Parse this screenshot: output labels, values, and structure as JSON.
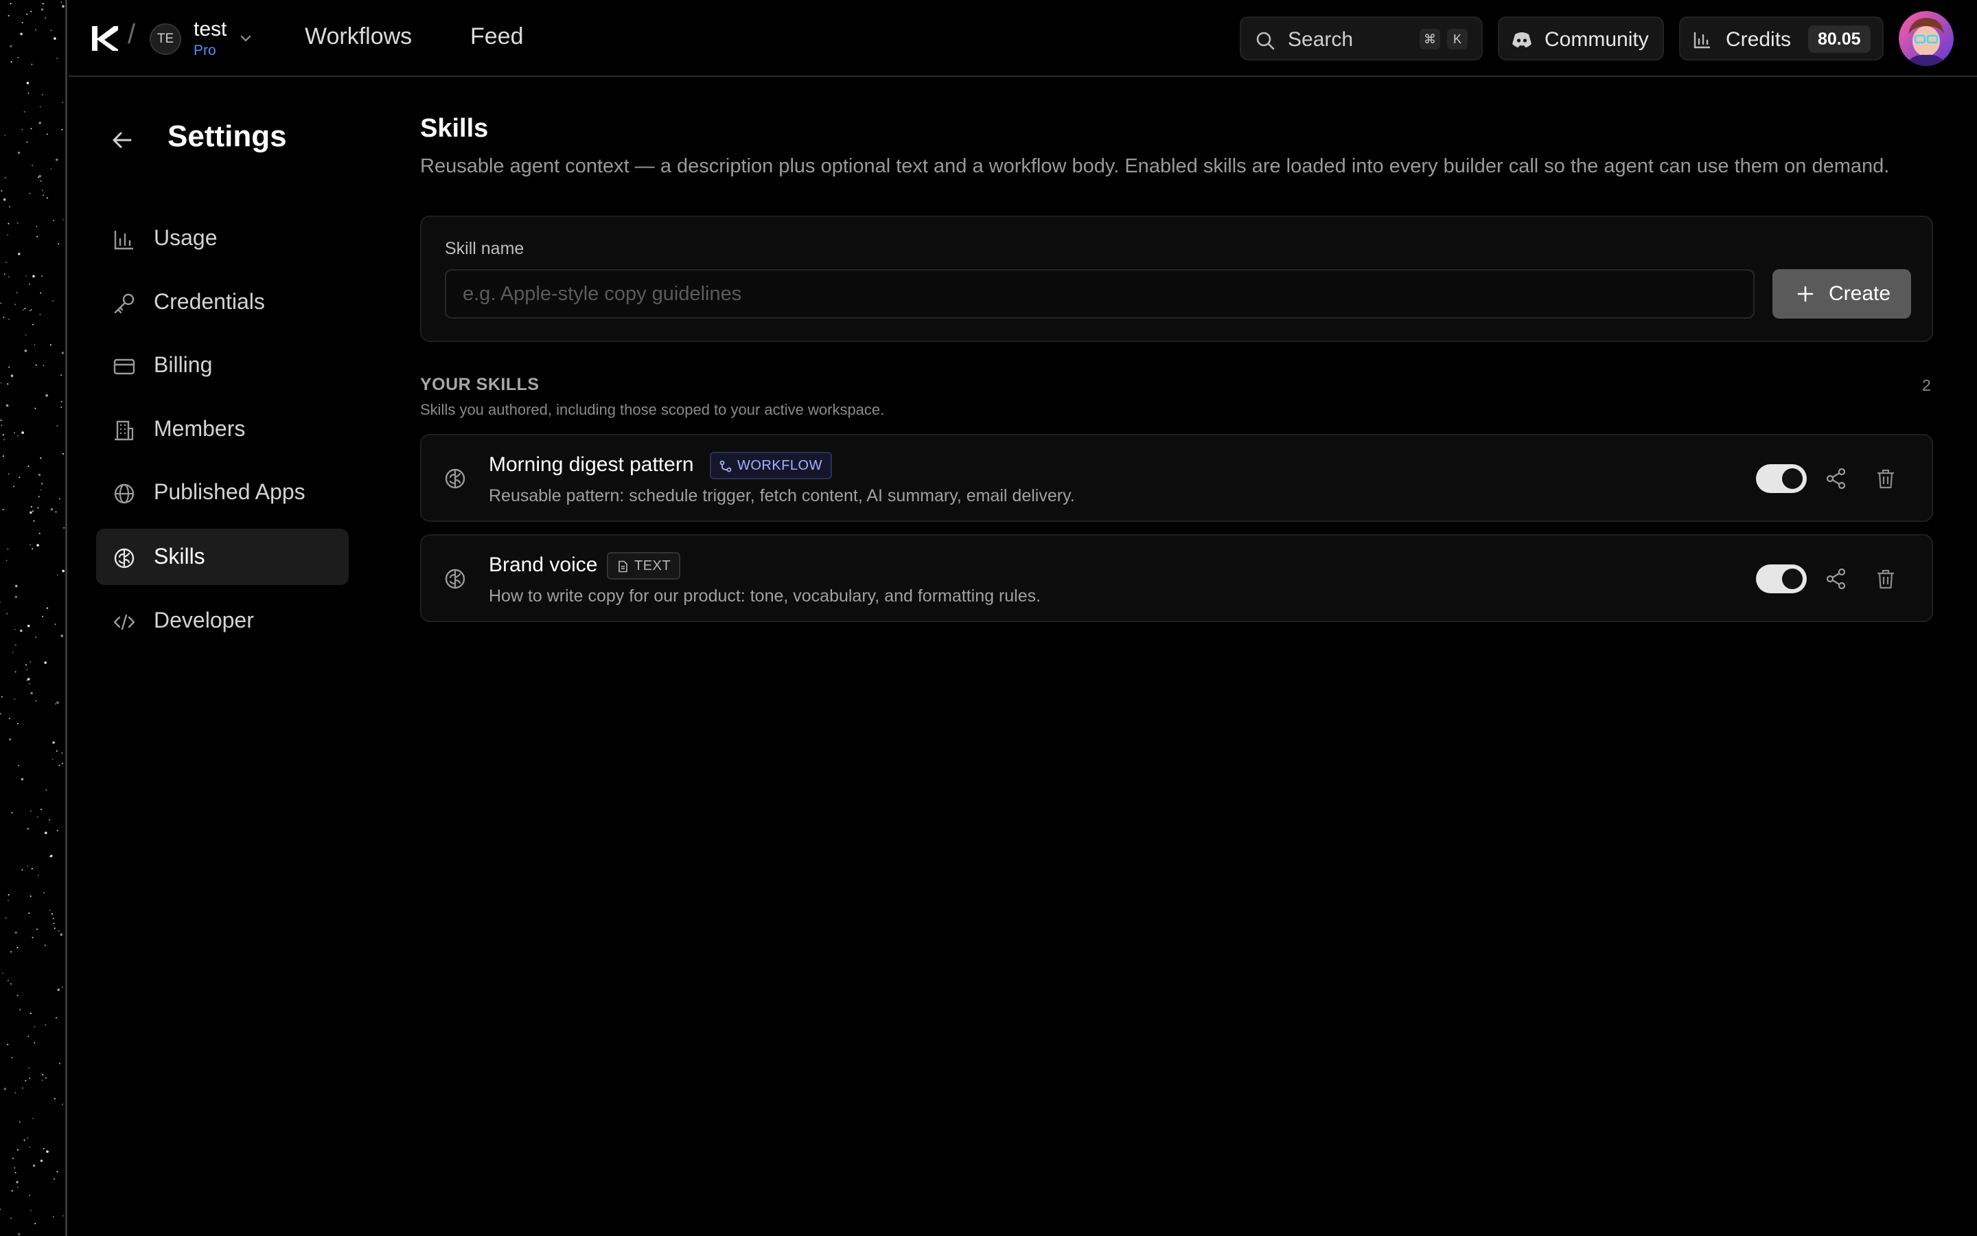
{
  "workspace": {
    "initials": "TE",
    "name": "test",
    "plan": "Pro"
  },
  "nav": {
    "workflows": "Workflows",
    "feed": "Feed"
  },
  "search": {
    "label": "Search",
    "shortcut_mod": "⌘",
    "shortcut_key": "K"
  },
  "community": {
    "label": "Community"
  },
  "credits": {
    "label": "Credits",
    "value": "80.05"
  },
  "sidebar": {
    "title": "Settings",
    "items": [
      {
        "label": "Usage",
        "icon": "chart-icon",
        "active": false
      },
      {
        "label": "Credentials",
        "icon": "key-icon",
        "active": false
      },
      {
        "label": "Billing",
        "icon": "card-icon",
        "active": false
      },
      {
        "label": "Members",
        "icon": "building-icon",
        "active": false
      },
      {
        "label": "Published Apps",
        "icon": "globe-icon",
        "active": false
      },
      {
        "label": "Skills",
        "icon": "brain-icon",
        "active": true
      },
      {
        "label": "Developer",
        "icon": "code-icon",
        "active": false
      }
    ]
  },
  "main": {
    "title": "Skills",
    "description": "Reusable agent context — a description plus optional text and a workflow body. Enabled skills are loaded into every builder call so the agent can use them on demand.",
    "form": {
      "label": "Skill name",
      "placeholder": "e.g. Apple-style copy guidelines",
      "value": "",
      "create_label": "Create"
    },
    "section": {
      "title": "YOUR SKILLS",
      "subtitle": "Skills you authored, including those scoped to your active workspace.",
      "count": "2"
    },
    "skills": [
      {
        "name": "Morning digest pattern",
        "tag": "WORKFLOW",
        "description": "Reusable pattern: schedule trigger, fetch content, AI summary, email delivery.",
        "enabled": true
      },
      {
        "name": "Brand voice",
        "tag": "TEXT",
        "description": "How to write copy for our product: tone, vocabulary, and formatting rules.",
        "enabled": true
      }
    ]
  },
  "colors": {
    "background": "#000000",
    "accent": "#5b8cff",
    "workflow_tag": "#a3b0ff"
  }
}
